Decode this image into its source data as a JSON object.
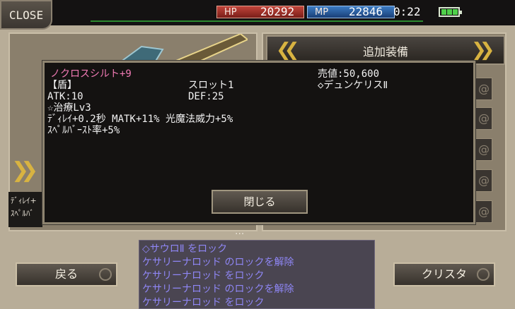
{
  "topbar": {
    "close_label": "CLOSE",
    "hp_label": "HP",
    "hp_value": "20292",
    "mp_label": "MP",
    "mp_value": "22846",
    "time": "0:22"
  },
  "equip_header": {
    "title": "追加装備"
  },
  "left_fragment": {
    "line1": "ﾃﾞｨﾚｲ+",
    "line2": "ｽﾍﾟﾙﾊﾞ"
  },
  "popup": {
    "item_name": "ノクロスシルト+9",
    "sell_value": "売値:50,600",
    "type": "【盾】",
    "slot": "スロット1",
    "set_name": "◇デュンケリスⅡ",
    "atk": "ATK:10",
    "def": "DEF:25",
    "skill": "☆治療Lv3",
    "effects_line1": "ﾃﾞｨﾚｲ+0.2秒 MATK+11% 光魔法威力+5%",
    "effects_line2": "ｽﾍﾟﾙﾊﾞｰｽﾄ率+5%",
    "close_label": "閉じる",
    "more": "..."
  },
  "buttons": {
    "back_label": "戻る",
    "crystal_label": "クリスタ"
  },
  "log": [
    "◇サウロⅡ をロック",
    "ケサリーナロッド のロックを解除",
    "ケサリーナロッド をロック",
    "ケサリーナロッド のロックを解除",
    "ケサリーナロッド をロック"
  ],
  "colors": {
    "item_name": "#f07ab4",
    "log_text": "#8f86f5",
    "hp": "#c2443a",
    "mp": "#3b7cc4",
    "accent_gold": "#d8b341"
  }
}
